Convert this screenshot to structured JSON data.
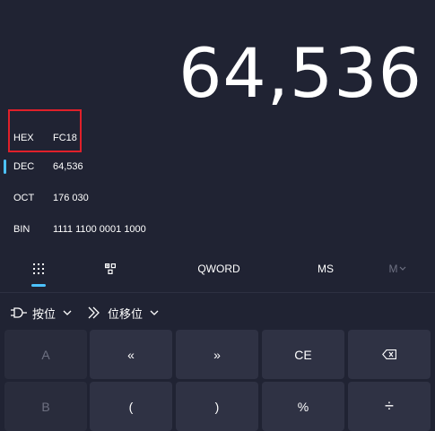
{
  "display": {
    "value": "64,536"
  },
  "radix": [
    {
      "label": "HEX",
      "value": "FC18"
    },
    {
      "label": "DEC",
      "value": "64,536"
    },
    {
      "label": "OCT",
      "value": "176 030"
    },
    {
      "label": "BIN",
      "value": "1111 1100 0001 1000"
    }
  ],
  "modes": {
    "word_size": "QWORD",
    "memory_store": "MS",
    "memory_recall": "M"
  },
  "bitwise": {
    "bitwise_label": "按位",
    "bitshift_label": "位移位"
  },
  "keypad": {
    "row1": [
      "A",
      "«",
      "»",
      "CE",
      ""
    ],
    "row2": [
      "B",
      "(",
      ")",
      "%",
      "÷"
    ]
  },
  "colors": {
    "background": "#202333",
    "accent": "#4cc2ff",
    "key": "#2f3244",
    "highlight_box": "#e0202a"
  }
}
